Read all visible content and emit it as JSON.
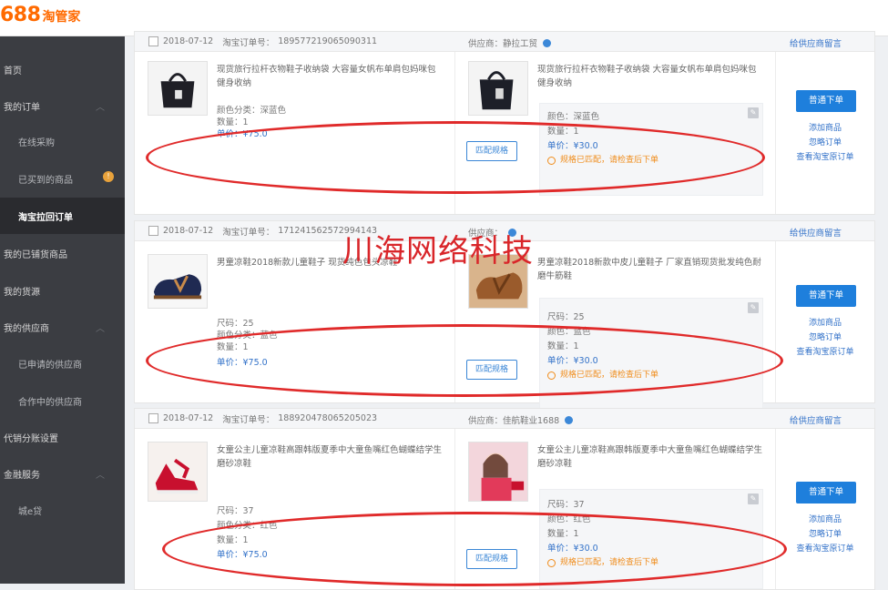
{
  "logo": {
    "number": "688",
    "text": "淘管家"
  },
  "sidebar": {
    "items": [
      {
        "label": "首页"
      },
      {
        "label": "我的订单"
      },
      {
        "label": "在线采购"
      },
      {
        "label": "已买到的商品",
        "badge": "!"
      },
      {
        "label": "淘宝拉回订单"
      },
      {
        "label": "我的已铺货商品"
      },
      {
        "label": "我的货源"
      },
      {
        "label": "我的供应商"
      },
      {
        "label": "已申请的供应商"
      },
      {
        "label": "合作中的供应商"
      },
      {
        "label": "代销分账设置"
      },
      {
        "label": "金融服务"
      },
      {
        "label": "城e贷"
      }
    ]
  },
  "orders": [
    {
      "date": "2018-07-12",
      "taobao_label": "淘宝订单号：",
      "taobao_no": "189577219065090311",
      "supplier": "供应商：静拉工贸",
      "message": "给供应商留言",
      "left_title": "现货旅行拉杆衣物鞋子收纳袋 大容量女帆布单肩包妈咪包 健身收纳",
      "left_specs": [
        "颜色分类：深蓝色",
        "数量：1"
      ],
      "left_price": "单价：¥75.0",
      "mid_title": "现货旅行拉杆衣物鞋子收纳袋 大容量女帆布单肩包妈咪包 健身收纳",
      "mid_specs": [
        "颜色：深蓝色",
        "数量：1"
      ],
      "mid_price": "单价：¥30.0",
      "warn": "规格已匹配，请检查后下单",
      "match": "匹配规格",
      "btn": "普通下单",
      "links": [
        "添加商品",
        "忽略订单",
        "查看淘宝原订单"
      ]
    },
    {
      "date": "2018-07-12",
      "taobao_label": "淘宝订单号：",
      "taobao_no": "171241562572994143",
      "supplier": "供应商：",
      "message": "给供应商留言",
      "left_title": "男童凉鞋2018新款儿童鞋子 现货纯色包头凉鞋",
      "left_specs": [
        "尺码：25",
        "颜色分类：蓝色",
        "数量：1"
      ],
      "left_price": "单价：¥75.0",
      "mid_title": "男童凉鞋2018新款中皮儿童鞋子 厂家直销现货批发纯色耐磨牛筋鞋",
      "mid_specs": [
        "尺码：25",
        "颜色：蓝色",
        "数量：1"
      ],
      "mid_price": "单价：¥30.0",
      "warn": "规格已匹配，请检查后下单",
      "match": "匹配规格",
      "btn": "普通下单",
      "links": [
        "添加商品",
        "忽略订单",
        "查看淘宝原订单"
      ]
    },
    {
      "date": "2018-07-12",
      "taobao_label": "淘宝订单号：",
      "taobao_no": "188920478065205023",
      "supplier": "供应商：佳航鞋业1688",
      "message": "给供应商留言",
      "left_title": "女童公主儿童凉鞋高跟韩版夏季中大童鱼嘴红色蝴蝶结学生磨砂凉鞋",
      "left_specs": [
        "尺码：37",
        "颜色分类：红色",
        "数量：1"
      ],
      "left_price": "单价：¥75.0",
      "mid_title": "女童公主儿童凉鞋高跟韩版夏季中大童鱼嘴红色蝴蝶结学生磨砂凉鞋",
      "mid_specs": [
        "尺码：37",
        "颜色：红色",
        "数量：1"
      ],
      "mid_price": "单价：¥30.0",
      "warn": "规格已匹配，请检查后下单",
      "match": "匹配规格",
      "btn": "普通下单",
      "links": [
        "添加商品",
        "忽略订单",
        "查看淘宝原订单"
      ]
    }
  ],
  "watermark": "川海网络科技",
  "colors": {
    "brand": "#ff6a00",
    "sidebar": "#3b3d42",
    "accent": "#1e7fdc",
    "warn": "#f08c1a",
    "annotation": "#e02a2a"
  }
}
